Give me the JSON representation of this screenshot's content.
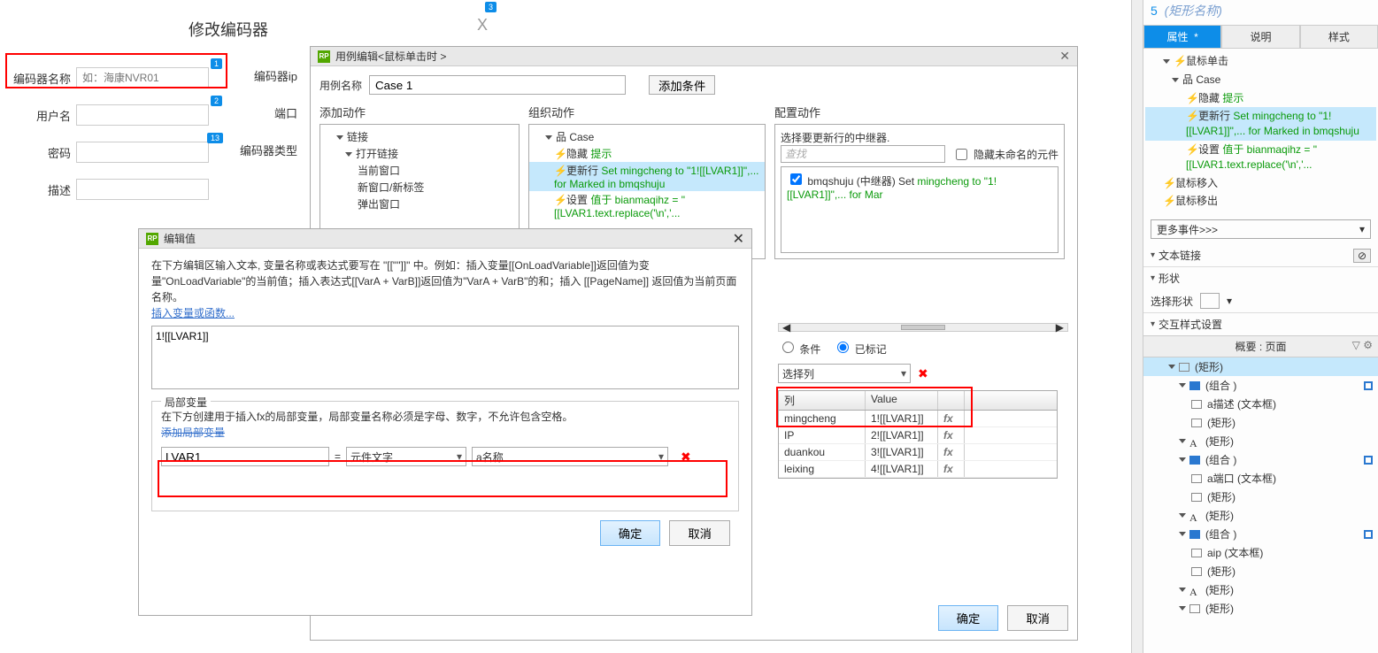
{
  "form": {
    "title": "修改编码器",
    "x_badge": "3",
    "fields": {
      "name_label": "编码器名称",
      "name_placeholder": "如：海康NVR01",
      "name_badge": "1",
      "ip_label": "编码器ip",
      "user_label": "用户名",
      "user_badge": "2",
      "port_label": "端口",
      "pwd_label": "密码",
      "pwd_badge": "13",
      "type_label": "编码器类型",
      "desc_label": "描述"
    }
  },
  "case_editor": {
    "title": "用例编辑<鼠标单击时 >",
    "case_name_label": "用例名称",
    "case_name_value": "Case 1",
    "add_cond_btn": "添加条件",
    "col1_hdr": "添加动作",
    "col2_hdr": "组织动作",
    "col3_hdr": "配置动作",
    "col1_items": {
      "link": "链接",
      "open": "打开链接",
      "cur": "当前窗口",
      "newtab": "新窗口/新标签",
      "popup": "弹出窗口"
    },
    "col2_case": "Case",
    "col2_a": {
      "pre": "隐藏 ",
      "green": "提示"
    },
    "col2_b": {
      "pre": "更新行 ",
      "green": "Set mingcheng to \"1![[LVAR1]]\",... for Marked in bmqshuju"
    },
    "col2_c": {
      "pre": "设置 ",
      "green": "值于 bianmaqihz = \"[[LVAR1.text.replace('\\n','..."
    },
    "col3_top": "选择要更新行的中继器.",
    "search_ph": "查找",
    "hide_unnamed": "隐藏未命名的元件",
    "c3_item_pre": "bmqshuju (中继器) Set ",
    "c3_item_green": "mingcheng to \"1![[LVAR1]]\",... for Mar",
    "rad_cond": "条件",
    "rad_marked": "已标记",
    "sel_col": "选择列",
    "tbl_h1": "列",
    "tbl_h2": "Value",
    "rows": [
      {
        "c": "mingcheng",
        "v": "1![[LVAR1]]"
      },
      {
        "c": "IP",
        "v": "2![[LVAR1]]"
      },
      {
        "c": "duankou",
        "v": "3![[LVAR1]]"
      },
      {
        "c": "leixing",
        "v": "4![[LVAR1]]"
      }
    ],
    "ok": "确定",
    "cancel": "取消"
  },
  "edit_value": {
    "title": "编辑值",
    "para": "在下方编辑区输入文本, 变量名称或表达式要写在 \"[[\"\"]]\" 中。例如：插入变量[[OnLoadVariable]]返回值为变量\"OnLoadVariable\"的当前值；插入表达式[[VarA + VarB]]返回值为\"VarA + VarB\"的和；插入 [[PageName]] 返回值为当前页面名称。",
    "insert_link": "插入变量或函数...",
    "textarea": "1![[LVAR1]]",
    "legend": "局部变量",
    "local_para": "在下方创建用于插入fx的局部变量，局部变量名称必须是字母、数字，不允许包含空格。",
    "add_local": "添加局部变量",
    "lv_name": "LVAR1",
    "lv_eq": "=",
    "lv_type": "元件文字",
    "lv_target": "a名称",
    "ok": "确定",
    "cancel": "取消"
  },
  "right": {
    "top_num": "5",
    "top_name": "(矩形名称)",
    "tabs": {
      "prop": "属性",
      "star": "*",
      "notes": "说明",
      "style": "样式"
    },
    "ev": {
      "click": "鼠标单击",
      "case": "Case",
      "a": {
        "pre": "隐藏 ",
        "green": "提示"
      },
      "b": {
        "pre": "更新行 ",
        "green": "Set mingcheng to \"1![[LVAR1]]\",... for Marked in bmqshuju"
      },
      "c": {
        "pre": "设置 ",
        "green": "值于 bianmaqihz = \"[[LVAR1.text.replace('\\n','..."
      },
      "enter": "鼠标移入",
      "leave": "鼠标移出"
    },
    "more": "更多事件>>>",
    "textlink": "文本链接",
    "shape_hdr": "形状",
    "shape_lbl": "选择形状",
    "ix_hdr": "交互样式设置",
    "outline_hdr": "概要 : 页面",
    "ol": [
      {
        "lv": 0,
        "ico": "rect",
        "t": "(矩形)"
      },
      {
        "lv": 1,
        "ico": "folder",
        "t": "(组合 )",
        "sq": true
      },
      {
        "lv": 2,
        "ico": "rect",
        "t": "a描述 (文本框)"
      },
      {
        "lv": 2,
        "ico": "rect",
        "t": "(矩形)"
      },
      {
        "lv": 1,
        "ico": "letter",
        "t": "(矩形)"
      },
      {
        "lv": 1,
        "ico": "folder",
        "t": "(组合 )",
        "sq": true
      },
      {
        "lv": 2,
        "ico": "rect",
        "t": "a端口 (文本框)"
      },
      {
        "lv": 2,
        "ico": "rect",
        "t": "(矩形)"
      },
      {
        "lv": 1,
        "ico": "letter",
        "t": "(矩形)"
      },
      {
        "lv": 1,
        "ico": "folder",
        "t": "(组合 )",
        "sq": true
      },
      {
        "lv": 2,
        "ico": "rect",
        "t": "aip (文本框)"
      },
      {
        "lv": 2,
        "ico": "rect",
        "t": "(矩形)"
      },
      {
        "lv": 1,
        "ico": "letter",
        "t": "(矩形)"
      },
      {
        "lv": 1,
        "ico": "rect",
        "t": "(矩形)"
      }
    ]
  }
}
